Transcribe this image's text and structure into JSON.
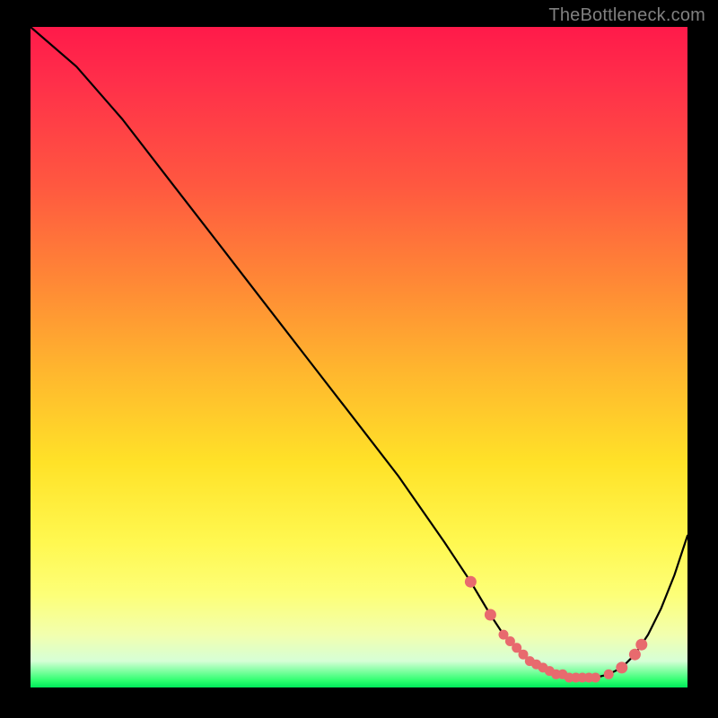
{
  "attribution": "TheBottleneck.com",
  "chart_data": {
    "type": "line",
    "title": "",
    "xlabel": "",
    "ylabel": "",
    "xlim": [
      0,
      100
    ],
    "ylim": [
      0,
      100
    ],
    "series": [
      {
        "name": "bottleneck-curve",
        "x": [
          0,
          7,
          14,
          21,
          28,
          35,
          42,
          49,
          56,
          63,
          67,
          70,
          72,
          74,
          76,
          78,
          80,
          82,
          84,
          86,
          88,
          90,
          92,
          94,
          96,
          98,
          100
        ],
        "values": [
          100,
          94,
          86,
          77,
          68,
          59,
          50,
          41,
          32,
          22,
          16,
          11,
          8,
          6,
          4,
          3,
          2,
          1.5,
          1.5,
          1.5,
          2,
          3,
          5,
          8,
          12,
          17,
          23
        ]
      }
    ],
    "highlight_points": {
      "name": "optimal-range-dots",
      "x": [
        67,
        70,
        72,
        73,
        74,
        75,
        76,
        77,
        78,
        79,
        80,
        81,
        82,
        83,
        84,
        85,
        86,
        88,
        90,
        92,
        93
      ],
      "values": [
        16,
        11,
        8,
        7,
        6,
        5,
        4,
        3.5,
        3,
        2.5,
        2,
        2,
        1.5,
        1.5,
        1.5,
        1.5,
        1.5,
        2,
        3,
        5,
        6.5
      ]
    },
    "gradient_stops": [
      {
        "pos": 0,
        "color": "#ff1a4a"
      },
      {
        "pos": 24,
        "color": "#ff5840"
      },
      {
        "pos": 52,
        "color": "#ffb62e"
      },
      {
        "pos": 78,
        "color": "#fff850"
      },
      {
        "pos": 96,
        "color": "#d6ffd6"
      },
      {
        "pos": 100,
        "color": "#00e85a"
      }
    ]
  }
}
